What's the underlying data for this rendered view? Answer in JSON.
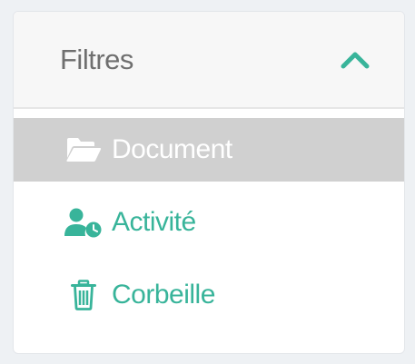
{
  "filters_panel": {
    "title": "Filtres",
    "toggle_icon": "chevron-up-icon",
    "items": [
      {
        "label": "Document",
        "icon": "folder-open-icon",
        "active": true
      },
      {
        "label": "Activité",
        "icon": "user-clock-icon",
        "active": false
      },
      {
        "label": "Corbeille",
        "icon": "trash-icon",
        "active": false
      }
    ]
  },
  "colors": {
    "accent": "#38b49a",
    "active_bg": "#d0d0d0",
    "header_bg": "#f7f7f7",
    "title_text": "#6f6f6f"
  }
}
